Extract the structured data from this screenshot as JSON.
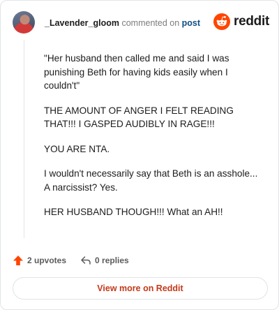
{
  "comment": {
    "author": "_Lavender_gloom",
    "verb": "commented on",
    "post_link": "post",
    "paragraphs": [
      "\"Her husband then called me and said I was punishing Beth for having kids easily when I couldn't\"",
      "THE AMOUNT OF ANGER I FELT READING THAT!!! I GASPED AUDIBLY IN RAGE!!!",
      "YOU ARE NTA.",
      "I wouldn't necessarily say that Beth is an asshole... A narcissist? Yes.",
      "HER HUSBAND THOUGH!!! What an AH!!"
    ]
  },
  "brand": {
    "name": "reddit",
    "icon": "reddit-alien-icon",
    "color": "#ff4500"
  },
  "footer": {
    "upvotes_label": "2 upvotes",
    "upvote_icon": "upvote-arrow-icon",
    "replies_label": "0 replies",
    "reply_icon": "reply-arrow-icon"
  },
  "view_more_label": "View more on Reddit",
  "colors": {
    "accent": "#ff4500",
    "link": "#0f4f84",
    "view_more_text": "#c23a1a"
  }
}
